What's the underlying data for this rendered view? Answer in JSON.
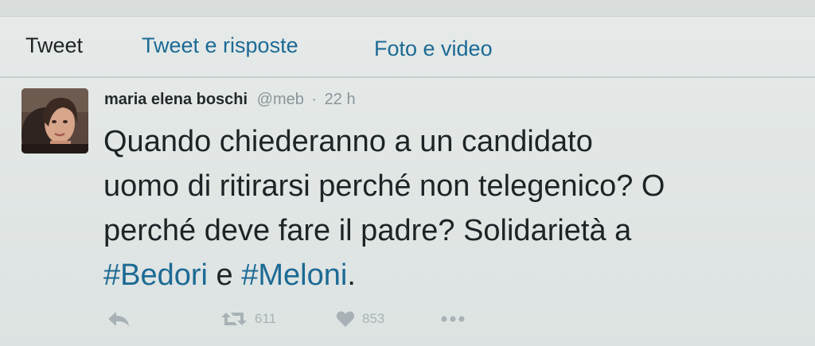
{
  "tabs": [
    {
      "label": "Tweet",
      "active": true
    },
    {
      "label": "Tweet e risposte",
      "active": false
    },
    {
      "label": "Foto e video",
      "active": false
    }
  ],
  "tweet": {
    "author_name": "maria elena boschi",
    "handle": "@meb",
    "separator": "·",
    "time": "22 h",
    "text_lines": [
      "Quando chiederanno a un candidato",
      "uomo di ritirarsi perché non telegenico? O",
      "perché deve fare il padre? Solidarietà a"
    ],
    "last_line": {
      "hashtag1": "#Bedori",
      "conjunction": "e",
      "hashtag2": "#Meloni",
      "trailing": "."
    },
    "actions": {
      "reply_icon": "reply-icon",
      "retweet_icon": "retweet-icon",
      "retweet_count": "611",
      "like_icon": "heart-icon",
      "like_count": "853",
      "more_icon": "more-icon"
    }
  },
  "colors": {
    "link": "#1c6a94",
    "text": "#1e2326",
    "muted": "#8a9499",
    "action_gray": "#a8b2b6",
    "background": "#e2e7e6"
  }
}
